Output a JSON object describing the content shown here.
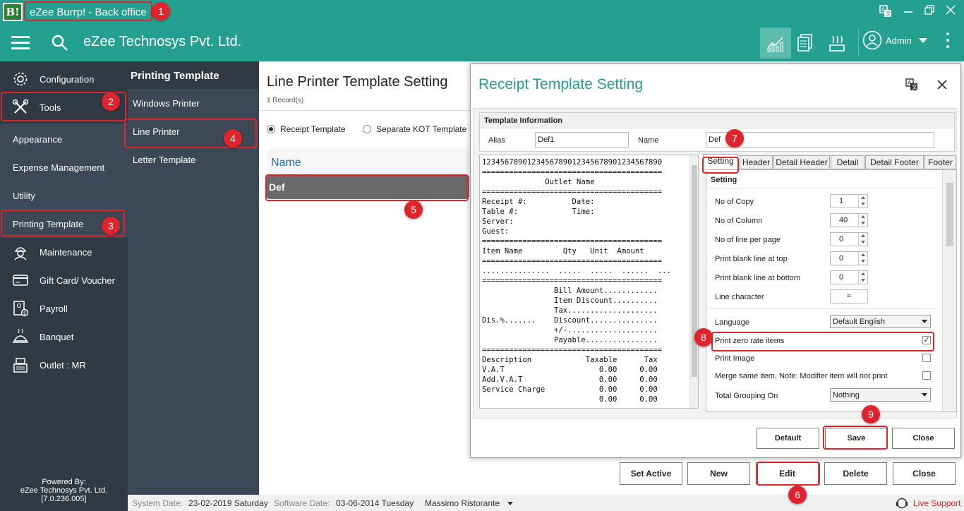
{
  "window": {
    "logo_text": "B!",
    "title": "eZee Burrp! - Back office"
  },
  "header": {
    "company": "eZee Technosys Pvt. Ltd.",
    "user": "Admin"
  },
  "sidebar": {
    "items": [
      {
        "label": "Configuration",
        "icon": "gear-icon"
      },
      {
        "label": "Tools",
        "icon": "tools-icon"
      },
      {
        "label": "Maintenance",
        "icon": "worker-icon"
      },
      {
        "label": "Gift Card/ Voucher",
        "icon": "card-icon"
      },
      {
        "label": "Payroll",
        "icon": "payroll-icon"
      },
      {
        "label": "Banquet",
        "icon": "banquet-icon"
      },
      {
        "label": "Outlet : MR",
        "icon": "register-icon"
      }
    ],
    "tools_sub": [
      "Appearance",
      "Expense Management",
      "Utility",
      "Printing Template"
    ],
    "powered_by": [
      "Powered By:",
      "eZee Technosys Pvt. Ltd.",
      "[7.0.236.005]"
    ]
  },
  "submenu": {
    "title": "Printing Template",
    "items": [
      "Windows Printer",
      "Line Printer",
      "Letter Template"
    ]
  },
  "main": {
    "title": "Line Printer Template Setting",
    "records": "1 Record(s)",
    "radio_receipt": "Receipt Template",
    "radio_kot": "Separate KOT Template",
    "column_name": "Name",
    "rows": [
      "Def"
    ],
    "buttons": {
      "set_active": "Set Active",
      "new": "New",
      "edit": "Edit",
      "delete": "Delete",
      "close": "Close"
    }
  },
  "status": {
    "system_date_label": "System Date:",
    "system_date": "23-02-2019 Saturday",
    "software_date_label": "Software Date:",
    "software_date": "03-06-2014 Tuesday",
    "outlet": "Massimo Ristorante",
    "live_support": "Live Support"
  },
  "dialog": {
    "title": "Receipt Template Setting",
    "template_info": "Template Information",
    "alias_label": "Alias",
    "alias_value": "Def1",
    "name_label": "Name",
    "name_value": "Def",
    "preview_text": "1234567890123456789012345678901234567890\n========================================\n              Outlet Name\n========================================\nReceipt #:          Date:\nTable #:            Time:\nServer:\nGuest:\n========================================\nItem Name         Qty   Unit  Amount\n========================================\n...............  .....  .....  ......  ...\n========================================\n                Bill Amount............\n                Item Discount..........\n                Tax....................\nDis.%.......    Discount...............\n                +/-....................\n                Payable................\n========================================\nDescription            Taxable      Tax\nV.A.T                     0.00     0.00\nAdd.V.A.T                 0.00     0.00\nService Charge            0.00     0.00\n                          0.00     0.00",
    "tabs": [
      "Setting",
      "Header",
      "Detail Header",
      "Detail",
      "Detail Footer",
      "Footer"
    ],
    "setting_head": "Setting",
    "settings": {
      "no_of_copy": {
        "label": "No of Copy",
        "value": "1"
      },
      "no_of_column": {
        "label": "No of Column",
        "value": "40"
      },
      "no_of_line": {
        "label": "No of line per page",
        "value": "0"
      },
      "blank_top": {
        "label": "Print blank line at top",
        "value": "0"
      },
      "blank_bottom": {
        "label": "Print blank line at bottom",
        "value": "0"
      },
      "line_char": {
        "label": "Line character",
        "value": "="
      },
      "language": {
        "label": "Language",
        "value": "Default English"
      },
      "zero_rate": {
        "label": "Print zero rate items",
        "checked": "✓"
      },
      "print_image": {
        "label": "Print Image"
      },
      "merge": {
        "label": "Merge same item,  Note: Modifier item will not print"
      },
      "grouping": {
        "label": "Total Grouping On",
        "value": "Nothing"
      }
    },
    "buttons": {
      "default": "Default",
      "save": "Save",
      "close": "Close"
    }
  },
  "annotations": [
    "1",
    "2",
    "3",
    "4",
    "5",
    "6",
    "7",
    "8",
    "9"
  ],
  "colors": {
    "teal": "#24a091",
    "sidebar": "#2f3a45",
    "marker": "#e0242e"
  }
}
